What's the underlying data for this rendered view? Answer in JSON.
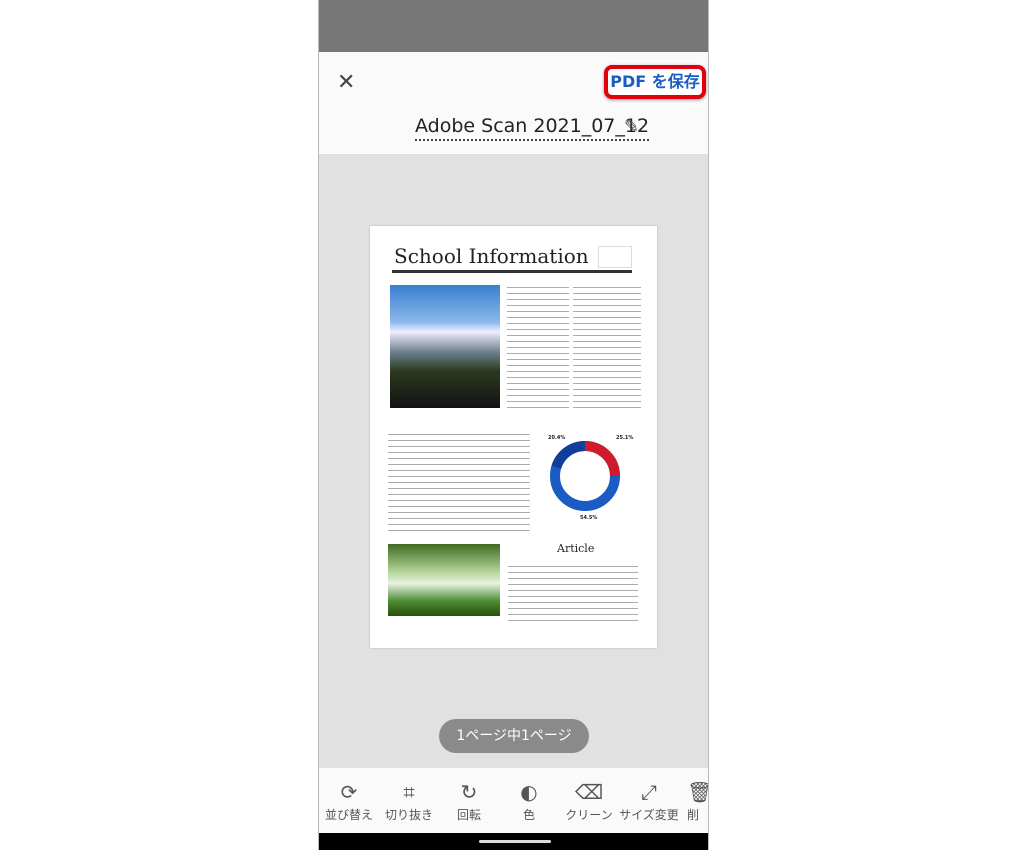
{
  "header": {
    "close_icon": "close-icon",
    "save_label": "PDF を保存",
    "title": "Adobe Scan 2021_07_12",
    "edit_icon": "pencil-icon",
    "save_highlight_color": "#e0000f",
    "accent": "#1a5bc4"
  },
  "document": {
    "title": "School Information",
    "article_heading": "Article",
    "chart_labels": [
      "20.4%",
      "25.1%",
      "54.5%"
    ]
  },
  "pager": {
    "label": "1ページ中1ページ"
  },
  "toolbar": {
    "items": [
      {
        "label": "並び替え",
        "icon": "reorder-icon"
      },
      {
        "label": "切り抜き",
        "icon": "crop-icon"
      },
      {
        "label": "回転",
        "icon": "rotate-icon"
      },
      {
        "label": "色",
        "icon": "color-icon"
      },
      {
        "label": "クリーン",
        "icon": "eraser-icon"
      },
      {
        "label": "サイズ変更",
        "icon": "resize-icon"
      },
      {
        "label": "削",
        "icon": "trash-icon"
      }
    ]
  }
}
